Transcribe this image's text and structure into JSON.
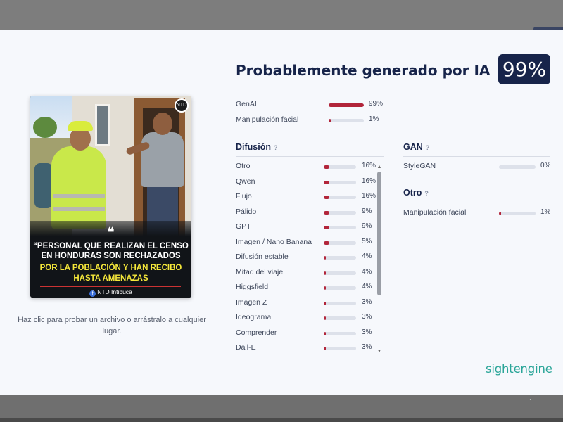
{
  "header": {
    "title": "Probablemente generado por IA",
    "score": "99%"
  },
  "summary": [
    {
      "label": "GenAI",
      "value": 0.99,
      "pct": "99%"
    },
    {
      "label": "Manipulación facial",
      "value": 0.01,
      "pct": "1%"
    }
  ],
  "diffusion": {
    "title": "Difusión",
    "help": "?",
    "items": [
      {
        "label": "Otro",
        "value": 0.16,
        "pct": "16%"
      },
      {
        "label": "Qwen",
        "value": 0.16,
        "pct": "16%"
      },
      {
        "label": "Flujo",
        "value": 0.16,
        "pct": "16%"
      },
      {
        "label": "Pálido",
        "value": 0.09,
        "pct": "9%"
      },
      {
        "label": "GPT",
        "value": 0.09,
        "pct": "9%"
      },
      {
        "label": "Imagen / Nano Banana",
        "value": 0.05,
        "pct": "5%"
      },
      {
        "label": "Difusión estable",
        "value": 0.04,
        "pct": "4%"
      },
      {
        "label": "Mitad del viaje",
        "value": 0.04,
        "pct": "4%"
      },
      {
        "label": "Higgsfield",
        "value": 0.04,
        "pct": "4%"
      },
      {
        "label": "Imagen Z",
        "value": 0.03,
        "pct": "3%"
      },
      {
        "label": "Ideograma",
        "value": 0.03,
        "pct": "3%"
      },
      {
        "label": "Comprender",
        "value": 0.03,
        "pct": "3%"
      },
      {
        "label": "Dall-E",
        "value": 0.03,
        "pct": "3%"
      }
    ]
  },
  "gan": {
    "title": "GAN",
    "help": "?",
    "items": [
      {
        "label": "StyleGAN",
        "value": 0.0,
        "pct": "0%"
      }
    ]
  },
  "other": {
    "title": "Otro",
    "help": "?",
    "items": [
      {
        "label": "Manipulación facial",
        "value": 0.01,
        "pct": "1%"
      }
    ]
  },
  "image": {
    "caption_line1": "“PERSONAL QUE REALIZAN EL CENSO",
    "caption_line2": "EN HONDURAS SON RECHAZADOS",
    "caption_line3": "POR LA POBLACIÓN Y HAN RECIBO",
    "caption_line4": "HASTA AMENAZAS",
    "quote_mark": "❝",
    "source": "NTD Intibuca",
    "badge": "NTD"
  },
  "upload_hint": "Haz clic para probar un archivo o arrástralo a cualquier lugar.",
  "brand": "sightengine",
  "colors": {
    "navy": "#17244a",
    "bar_fill": "#b2253a",
    "bar_track": "#dde1ea",
    "brand": "#2aa598"
  }
}
